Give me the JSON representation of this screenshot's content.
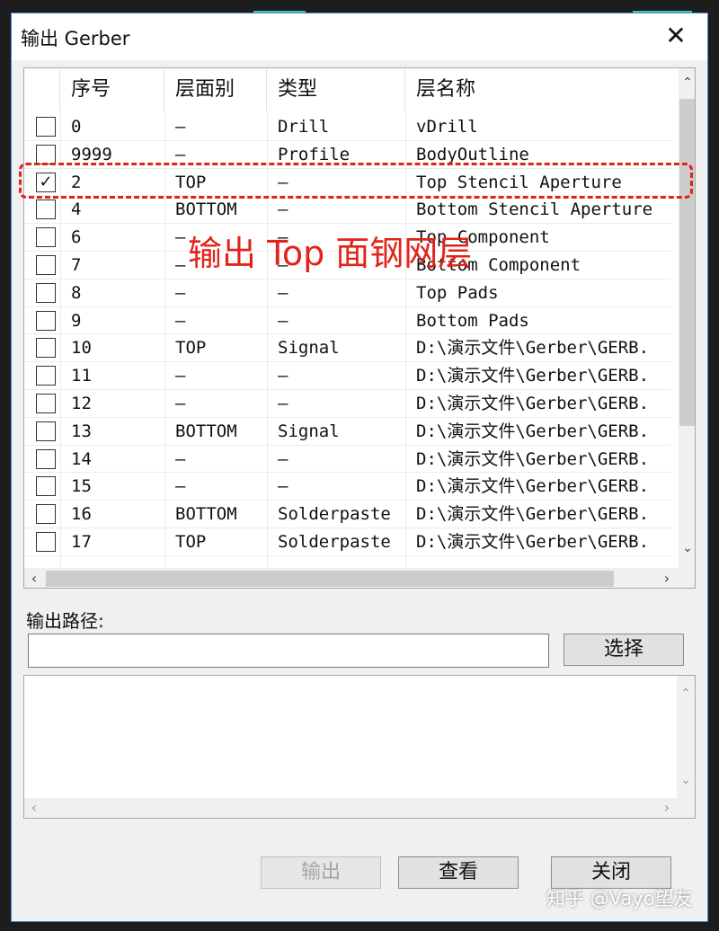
{
  "window": {
    "title": "输出 Gerber",
    "close_glyph": "✕"
  },
  "table": {
    "headers": [
      "序号",
      "层面别",
      "类型",
      "层名称"
    ],
    "rows": [
      {
        "checked": false,
        "num": "0",
        "side": "—",
        "type": "Drill",
        "name": "vDrill"
      },
      {
        "checked": false,
        "num": "9999",
        "side": "—",
        "type": "Profile",
        "name": "BodyOutline"
      },
      {
        "checked": true,
        "num": "2",
        "side": "TOP",
        "type": "—",
        "name": "Top Stencil Aperture"
      },
      {
        "checked": false,
        "num": "4",
        "side": "BOTTOM",
        "type": "—",
        "name": "Bottom Stencil Aperture"
      },
      {
        "checked": false,
        "num": "6",
        "side": "—",
        "type": "—",
        "name": "Top Component"
      },
      {
        "checked": false,
        "num": "7",
        "side": "—",
        "type": "—",
        "name": "Bottom Component"
      },
      {
        "checked": false,
        "num": "8",
        "side": "—",
        "type": "—",
        "name": "Top Pads"
      },
      {
        "checked": false,
        "num": "9",
        "side": "—",
        "type": "—",
        "name": "Bottom Pads"
      },
      {
        "checked": false,
        "num": "10",
        "side": "TOP",
        "type": "Signal",
        "name": "D:\\演示文件\\Gerber\\GERB."
      },
      {
        "checked": false,
        "num": "11",
        "side": "—",
        "type": "—",
        "name": "D:\\演示文件\\Gerber\\GERB."
      },
      {
        "checked": false,
        "num": "12",
        "side": "—",
        "type": "—",
        "name": "D:\\演示文件\\Gerber\\GERB."
      },
      {
        "checked": false,
        "num": "13",
        "side": "BOTTOM",
        "type": "Signal",
        "name": "D:\\演示文件\\Gerber\\GERB."
      },
      {
        "checked": false,
        "num": "14",
        "side": "—",
        "type": "—",
        "name": "D:\\演示文件\\Gerber\\GERB."
      },
      {
        "checked": false,
        "num": "15",
        "side": "—",
        "type": "—",
        "name": "D:\\演示文件\\Gerber\\GERB."
      },
      {
        "checked": false,
        "num": "16",
        "side": "BOTTOM",
        "type": "Solderpaste",
        "name": "D:\\演示文件\\Gerber\\GERB."
      },
      {
        "checked": false,
        "num": "17",
        "side": "TOP",
        "type": "Solderpaste",
        "name": "D:\\演示文件\\Gerber\\GERB."
      }
    ],
    "check_glyph": "✓",
    "scroll_up": "⌃",
    "scroll_down": "⌄",
    "scroll_left": "‹",
    "scroll_right": "›"
  },
  "annotation": {
    "text": "输出 Top 面钢网层",
    "color": "#e2231a"
  },
  "output_path": {
    "label": "输出路径:",
    "value": "",
    "browse_label": "选择"
  },
  "buttons": {
    "export": "输出",
    "view": "查看",
    "close": "关闭"
  },
  "watermark": "知乎 @Vayo望友",
  "colors": {
    "dialog_border": "#4a8fd6",
    "accent": "#44c2b8",
    "highlight": "#e2231a"
  }
}
